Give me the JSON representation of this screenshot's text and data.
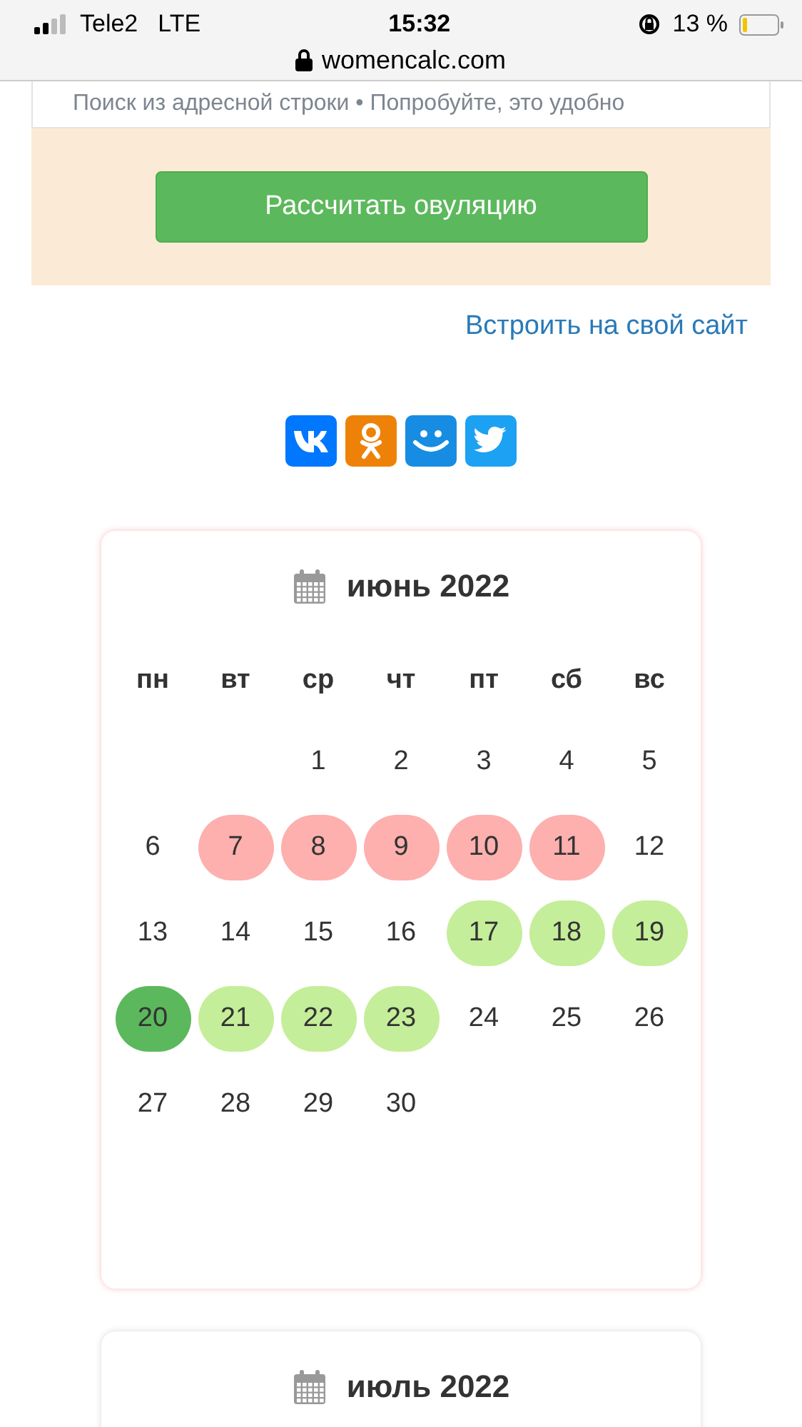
{
  "status_bar": {
    "carrier": "Tele2",
    "network": "LTE",
    "time": "15:32",
    "battery": "13 %"
  },
  "address_bar": {
    "url": "womencalc.com"
  },
  "search_hint": "Поиск из адресной строки • Попробуйте, это удобно",
  "calculate_button": "Рассчитать овуляцию",
  "embed_link": "Встроить на свой сайт",
  "share_buttons": [
    {
      "kind": "vk",
      "color": "#0077ff"
    },
    {
      "kind": "ok",
      "color": "#ee8208"
    },
    {
      "kind": "mm",
      "color": "#168de2"
    },
    {
      "kind": "twitter",
      "color": "#1da1f2"
    }
  ],
  "calendars": [
    {
      "title": "июнь 2022",
      "weekdays": [
        "пн",
        "вт",
        "ср",
        "чт",
        "пт",
        "сб",
        "вс"
      ],
      "weeks": [
        {
          "days": [
            {
              "kind": "blank"
            },
            {
              "kind": "blank"
            },
            {
              "label": "1",
              "kind": "plain"
            },
            {
              "label": "2",
              "kind": "plain"
            },
            {
              "label": "3",
              "kind": "plain"
            },
            {
              "label": "4",
              "kind": "plain"
            },
            {
              "label": "5",
              "kind": "plain"
            }
          ]
        },
        {
          "days": [
            {
              "label": "6",
              "kind": "plain"
            },
            {
              "label": "7",
              "kind": "period"
            },
            {
              "label": "8",
              "kind": "period"
            },
            {
              "label": "9",
              "kind": "period"
            },
            {
              "label": "10",
              "kind": "period"
            },
            {
              "label": "11",
              "kind": "period"
            },
            {
              "label": "12",
              "kind": "plain"
            }
          ]
        },
        {
          "days": [
            {
              "label": "13",
              "kind": "plain"
            },
            {
              "label": "14",
              "kind": "plain"
            },
            {
              "label": "15",
              "kind": "plain"
            },
            {
              "label": "16",
              "kind": "plain"
            },
            {
              "label": "17",
              "kind": "fertile"
            },
            {
              "label": "18",
              "kind": "fertile"
            },
            {
              "label": "19",
              "kind": "fertile"
            }
          ]
        },
        {
          "days": [
            {
              "label": "20",
              "kind": "ovulation"
            },
            {
              "label": "21",
              "kind": "fertile"
            },
            {
              "label": "22",
              "kind": "fertile"
            },
            {
              "label": "23",
              "kind": "fertile"
            },
            {
              "label": "24",
              "kind": "plain"
            },
            {
              "label": "25",
              "kind": "plain"
            },
            {
              "label": "26",
              "kind": "plain"
            }
          ]
        },
        {
          "days": [
            {
              "label": "27",
              "kind": "plain"
            },
            {
              "label": "28",
              "kind": "plain"
            },
            {
              "label": "29",
              "kind": "plain"
            },
            {
              "label": "30",
              "kind": "plain"
            }
          ]
        }
      ]
    },
    {
      "title": "июль 2022"
    }
  ]
}
